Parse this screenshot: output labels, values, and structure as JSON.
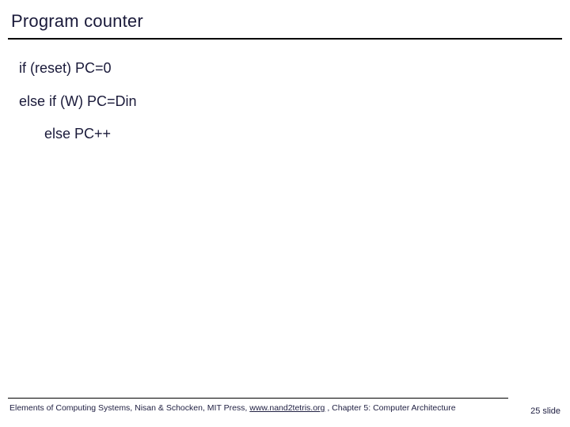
{
  "slide": {
    "title": "Program counter",
    "body": {
      "line1": "if (reset) PC=0",
      "line2": "else if (W) PC=Din",
      "line3": "else PC++"
    },
    "footer": {
      "prefix": "Elements of Computing Systems, Nisan & Schocken, MIT Press, ",
      "link": "www.nand2tetris.org",
      "suffix": " , Chapter 5: Computer Architecture"
    },
    "pagenum": "25 slide"
  }
}
